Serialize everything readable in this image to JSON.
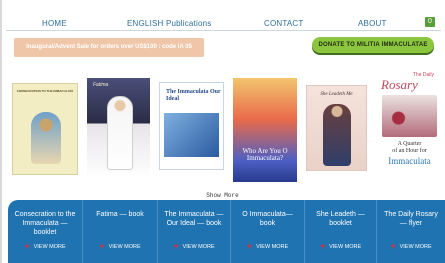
{
  "nav": {
    "items": [
      "HOME",
      "ENGLISH Publications",
      "CONTACT",
      "ABOUT"
    ],
    "cart_count": "0"
  },
  "banner": {
    "sale_text": "Inaugural/Advent Sale for orders over US$100 : code IA 05",
    "donate_text": "DONATE TO MILITIA IMMACULATAE"
  },
  "covers": {
    "c1_title": "CONSECRATION TO THE IMMACULATA",
    "c2_title": "Fatima",
    "c3_title": "The Immaculata Our Ideal",
    "c4_title": "Who Are You O Immaculata?",
    "c5_title": "She Leadeth Me",
    "c6_small": "The Daily",
    "c6_title": "Rosary",
    "c6_sub1": "A Quarter",
    "c6_sub2": "of an Hour for",
    "c6_sub3": "Immaculata"
  },
  "show_more": "Show More",
  "cards": [
    {
      "title": "Consecration to the Immaculata — booklet",
      "cta": "VIEW MORE"
    },
    {
      "title": "Fatima — book",
      "cta": "VIEW MORE"
    },
    {
      "title": "The Immaculata — Our Ideal — book",
      "cta": "VIEW MORE"
    },
    {
      "title": "O Immaculata— book",
      "cta": "VIEW MORE"
    },
    {
      "title": "She Leadeth — booklet",
      "cta": "VIEW MORE"
    },
    {
      "title": "The Daily Rosary — flyer",
      "cta": "VIEW MORE"
    }
  ],
  "colors": {
    "accent": "#1f73b0",
    "sale": "#f0c6a8",
    "donate": "#8cc63f",
    "plus": "#e8283b"
  }
}
